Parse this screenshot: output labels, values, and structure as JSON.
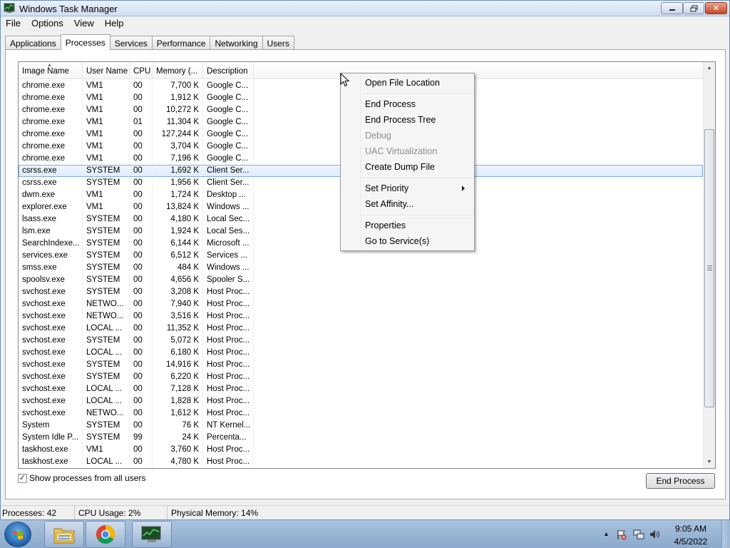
{
  "window": {
    "title": "Windows Task Manager"
  },
  "menu": [
    "File",
    "Options",
    "View",
    "Help"
  ],
  "tabs": [
    "Applications",
    "Processes",
    "Services",
    "Performance",
    "Networking",
    "Users"
  ],
  "columns": [
    "Image Name",
    "User Name",
    "CPU",
    "Memory (...",
    "Description"
  ],
  "processes": [
    [
      "chrome.exe",
      "VM1",
      "00",
      "7,700 K",
      "Google C..."
    ],
    [
      "chrome.exe",
      "VM1",
      "00",
      "1,912 K",
      "Google C..."
    ],
    [
      "chrome.exe",
      "VM1",
      "00",
      "10,272 K",
      "Google C..."
    ],
    [
      "chrome.exe",
      "VM1",
      "01",
      "11,304 K",
      "Google C..."
    ],
    [
      "chrome.exe",
      "VM1",
      "00",
      "127,244 K",
      "Google C..."
    ],
    [
      "chrome.exe",
      "VM1",
      "00",
      "3,704 K",
      "Google C..."
    ],
    [
      "chrome.exe",
      "VM1",
      "00",
      "7,196 K",
      "Google C..."
    ],
    [
      "csrss.exe",
      "SYSTEM",
      "00",
      "1,692 K",
      "Client Ser..."
    ],
    [
      "csrss.exe",
      "SYSTEM",
      "00",
      "1,956 K",
      "Client Ser..."
    ],
    [
      "dwm.exe",
      "VM1",
      "00",
      "1,724 K",
      "Desktop ..."
    ],
    [
      "explorer.exe",
      "VM1",
      "00",
      "13,824 K",
      "Windows ..."
    ],
    [
      "lsass.exe",
      "SYSTEM",
      "00",
      "4,180 K",
      "Local Sec..."
    ],
    [
      "lsm.exe",
      "SYSTEM",
      "00",
      "1,924 K",
      "Local Ses..."
    ],
    [
      "SearchIndexe...",
      "SYSTEM",
      "00",
      "6,144 K",
      "Microsoft ..."
    ],
    [
      "services.exe",
      "SYSTEM",
      "00",
      "6,512 K",
      "Services ..."
    ],
    [
      "smss.exe",
      "SYSTEM",
      "00",
      "484 K",
      "Windows ..."
    ],
    [
      "spoolsv.exe",
      "SYSTEM",
      "00",
      "4,656 K",
      "Spooler S..."
    ],
    [
      "svchost.exe",
      "SYSTEM",
      "00",
      "3,208 K",
      "Host Proc..."
    ],
    [
      "svchost.exe",
      "NETWO...",
      "00",
      "7,940 K",
      "Host Proc..."
    ],
    [
      "svchost.exe",
      "NETWO...",
      "00",
      "3,516 K",
      "Host Proc..."
    ],
    [
      "svchost.exe",
      "LOCAL ...",
      "00",
      "11,352 K",
      "Host Proc..."
    ],
    [
      "svchost.exe",
      "SYSTEM",
      "00",
      "5,072 K",
      "Host Proc..."
    ],
    [
      "svchost.exe",
      "LOCAL ...",
      "00",
      "6,180 K",
      "Host Proc..."
    ],
    [
      "svchost.exe",
      "SYSTEM",
      "00",
      "14,916 K",
      "Host Proc..."
    ],
    [
      "svchost.exe",
      "SYSTEM",
      "00",
      "6,220 K",
      "Host Proc..."
    ],
    [
      "svchost.exe",
      "LOCAL ...",
      "00",
      "7,128 K",
      "Host Proc..."
    ],
    [
      "svchost.exe",
      "LOCAL ...",
      "00",
      "1,828 K",
      "Host Proc..."
    ],
    [
      "svchost.exe",
      "NETWO...",
      "00",
      "1,612 K",
      "Host Proc..."
    ],
    [
      "System",
      "SYSTEM",
      "00",
      "76 K",
      "NT Kernel..."
    ],
    [
      "System Idle P...",
      "SYSTEM",
      "99",
      "24 K",
      "Percenta..."
    ],
    [
      "taskhost.exe",
      "VM1",
      "00",
      "3,760 K",
      "Host Proc..."
    ],
    [
      "taskhost.exe",
      "LOCAL ...",
      "00",
      "4,780 K",
      "Host Proc..."
    ]
  ],
  "selected_row": 7,
  "show_all_users": {
    "label": "Show processes from all users",
    "checked": "✓"
  },
  "end_process_button": "End Process",
  "status": {
    "processes": "Processes: 42",
    "cpu": "CPU Usage: 2%",
    "memory": "Physical Memory: 14%"
  },
  "context_menu": [
    {
      "label": "Open File Location",
      "enabled": true
    },
    {
      "label": "End Process",
      "enabled": true
    },
    {
      "label": "End Process Tree",
      "enabled": true
    },
    {
      "label": "Debug",
      "enabled": false
    },
    {
      "label": "UAC Virtualization",
      "enabled": false
    },
    {
      "label": "Create Dump File",
      "enabled": true
    },
    {
      "label": "Set Priority",
      "enabled": true,
      "submenu": true
    },
    {
      "label": "Set Affinity...",
      "enabled": true
    },
    {
      "label": "Properties",
      "enabled": true
    },
    {
      "label": "Go to Service(s)",
      "enabled": true
    }
  ],
  "taskbar": {
    "items": [
      "windows-explorer-icon",
      "chrome-icon",
      "task-manager-icon"
    ],
    "clock_time": "9:05 AM",
    "clock_date": "4/5/2022"
  },
  "colors": {
    "selection": "#dcebfc",
    "selection_border": "#84acdd",
    "close_button": "#c74524",
    "taskbar": "#8ba9cc"
  }
}
